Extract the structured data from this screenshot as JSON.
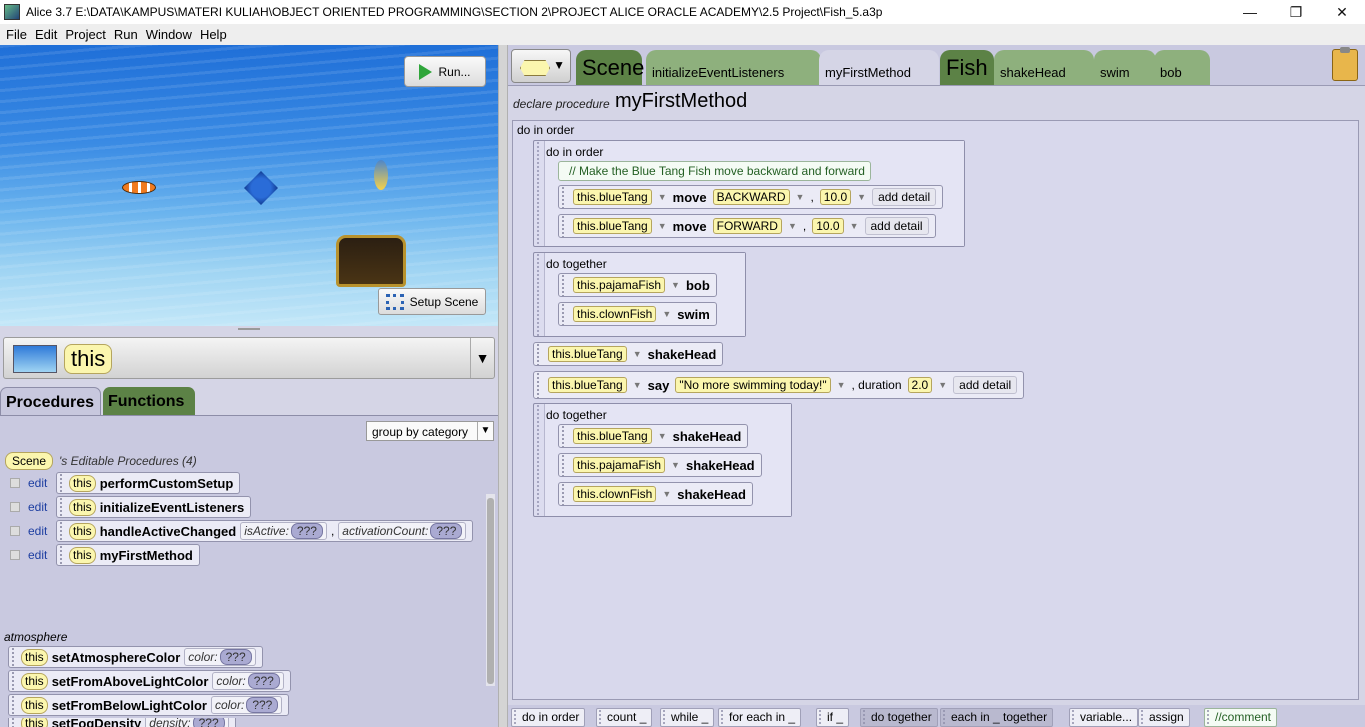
{
  "window": {
    "title": "Alice 3.7 E:\\DATA\\KAMPUS\\MATERI KULIAH\\OBJECT ORIENTED PROGRAMMING\\SECTION 2\\PROJECT ALICE ORACLE ACADEMY\\2.5 Project\\Fish_5.a3p",
    "controls": [
      "—",
      "❐",
      "✕"
    ]
  },
  "menu": [
    "File",
    "Edit",
    "Project",
    "Run",
    "Window",
    "Help"
  ],
  "scene_view": {
    "run_label": "Run...",
    "setup_label": "Setup Scene"
  },
  "selector": {
    "value": "this",
    "arrow": "▼"
  },
  "left_tabs": {
    "procedures": "Procedures",
    "functions": "Functions"
  },
  "group_by": {
    "value": "group by category",
    "arrow": "▼"
  },
  "editable": {
    "class_label": "Scene",
    "header": "'s Editable Procedures (4)",
    "edit_label": "edit",
    "this_label": "this",
    "items": [
      {
        "name": "performCustomSetup"
      },
      {
        "name": "initializeEventListeners"
      },
      {
        "name": "handleActiveChanged",
        "params": [
          {
            "label": "isActive:",
            "value": "???"
          },
          {
            "label": "activationCount:",
            "value": "???"
          }
        ]
      },
      {
        "name": "myFirstMethod"
      }
    ]
  },
  "atmosphere": {
    "label": "atmosphere",
    "items": [
      {
        "name": "setAtmosphereColor",
        "param": "color:",
        "value": "???"
      },
      {
        "name": "setFromAboveLightColor",
        "param": "color:",
        "value": "???"
      },
      {
        "name": "setFromBelowLightColor",
        "param": "color:",
        "value": "???"
      },
      {
        "name": "setFogDensity",
        "param": "density:",
        "value": "???"
      }
    ]
  },
  "editor_tabs": {
    "scene": "Scene",
    "items": [
      "initializeEventListeners",
      "myFirstMethod"
    ],
    "fish": "Fish",
    "fish_items": [
      "shakeHead",
      "swim",
      "bob"
    ],
    "active": "myFirstMethod"
  },
  "method": {
    "declare_label": "declare procedure",
    "name": "myFirstMethod",
    "main_block": "do in order",
    "block1": {
      "label": "do in order",
      "comment": "// Make the Blue Tang Fish move backward and forward",
      "s1": {
        "subject": "this.blueTang",
        "verb": "move",
        "dir": "BACKWARD",
        "amount": "10.0",
        "detail": "add detail"
      },
      "s2": {
        "subject": "this.blueTang",
        "verb": "move",
        "dir": "FORWARD",
        "amount": "10.0",
        "detail": "add detail"
      }
    },
    "block2": {
      "label": "do together",
      "s1": {
        "subject": "this.pajamaFish",
        "verb": "bob"
      },
      "s2": {
        "subject": "this.clownFish",
        "verb": "swim"
      }
    },
    "stmt3": {
      "subject": "this.blueTang",
      "verb": "shakeHead"
    },
    "stmt4": {
      "subject": "this.blueTang",
      "verb": "say",
      "text": "\"No more swimming today!\"",
      "duration_label": ", duration",
      "duration": "2.0",
      "detail": "add detail"
    },
    "block5": {
      "label": "do together",
      "s1": {
        "subject": "this.blueTang",
        "verb": "shakeHead"
      },
      "s2": {
        "subject": "this.pajamaFish",
        "verb": "shakeHead"
      },
      "s3": {
        "subject": "this.clownFish",
        "verb": "shakeHead"
      }
    }
  },
  "palette": [
    "do in order",
    "count _",
    "while _",
    "for each in _",
    "if _",
    "do together",
    "each in _ together",
    "variable...",
    "assign",
    "//comment"
  ]
}
